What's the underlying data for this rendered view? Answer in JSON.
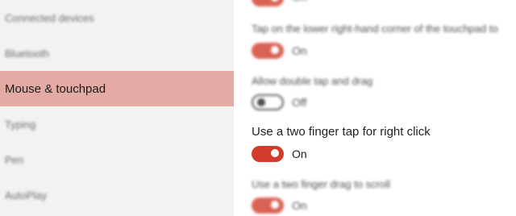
{
  "sidebar": {
    "items": [
      {
        "label": "Connected devices"
      },
      {
        "label": "Bluetooth"
      },
      {
        "label": "Mouse & touchpad"
      },
      {
        "label": "Typing"
      },
      {
        "label": "Pen"
      },
      {
        "label": "AutoPlay"
      }
    ],
    "active_index": 2
  },
  "settings": [
    {
      "label": "",
      "state": "On"
    },
    {
      "label": "Tap on the lower right-hand corner of the touchpad to",
      "state": "On"
    },
    {
      "label": "Allow double tap and drag",
      "state": "Off"
    },
    {
      "label": "Use a two finger tap for right click",
      "state": "On"
    },
    {
      "label": "Use a two finger drag to scroll",
      "state": "On"
    }
  ],
  "colors": {
    "accent": "#d23c2a",
    "active_highlight": "#e3aba3",
    "sidebar_bg": "#f2f2f2"
  }
}
